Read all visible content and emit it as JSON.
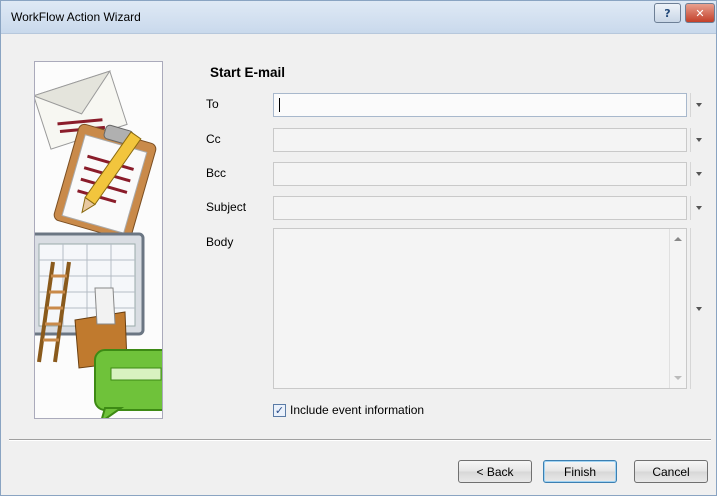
{
  "window": {
    "title": "WorkFlow Action Wizard",
    "help_label": "?",
    "close_label": "✕"
  },
  "page": {
    "title": "Start E-mail"
  },
  "fields": {
    "to": {
      "label": "To",
      "value": ""
    },
    "cc": {
      "label": "Cc",
      "value": ""
    },
    "bcc": {
      "label": "Bcc",
      "value": ""
    },
    "subject": {
      "label": "Subject",
      "value": ""
    },
    "body": {
      "label": "Body",
      "value": ""
    }
  },
  "checkbox": {
    "label": "Include event information",
    "checked": true,
    "mark": "✓"
  },
  "buttons": {
    "back": "< Back",
    "finish": "Finish",
    "cancel": "Cancel"
  },
  "icons": {
    "illustration": "wizard-illustration",
    "dropdown": "chevron-down-icon"
  },
  "colors": {
    "accent": "#3c7fb1",
    "title_bar": "#c9d9ec",
    "close": "#c3402a"
  }
}
